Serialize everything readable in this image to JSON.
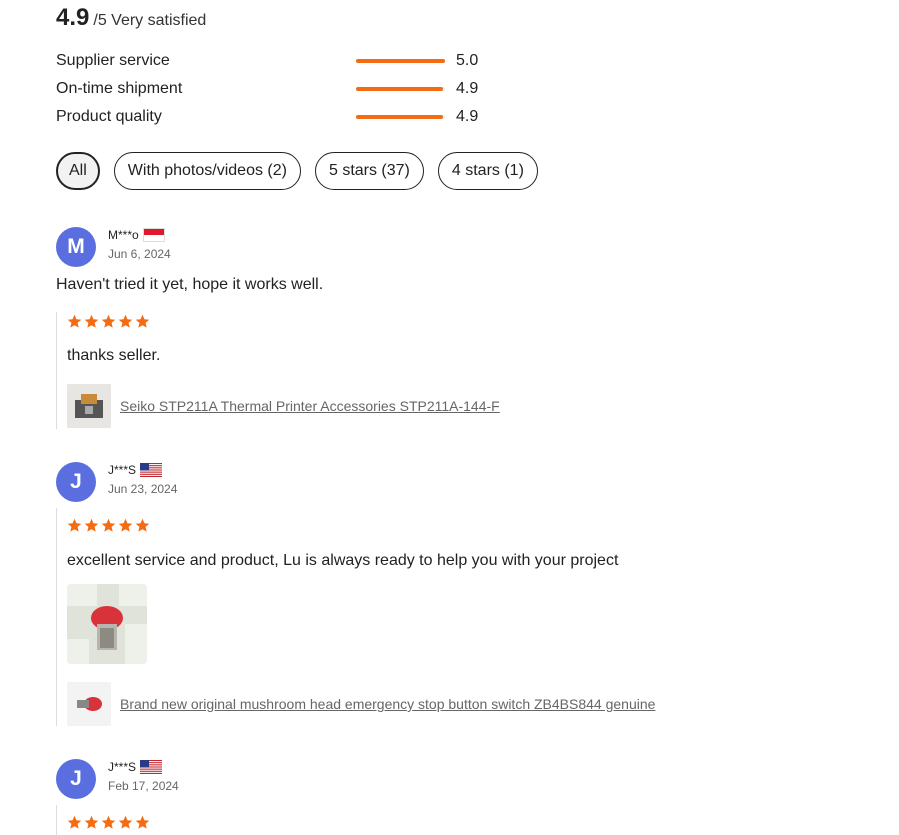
{
  "summary": {
    "score": "4.9",
    "score_sub": "/5 Very satisfied"
  },
  "metrics": [
    {
      "label": "Supplier service",
      "value": "5.0",
      "level": 1.0
    },
    {
      "label": "On-time shipment",
      "value": "4.9",
      "level": 0.98
    },
    {
      "label": "Product quality",
      "value": "4.9",
      "level": 0.98
    }
  ],
  "filters": [
    "All",
    "With photos/videos (2)",
    "5 stars (37)",
    "4 stars (1)"
  ],
  "reviews": [
    {
      "initial": "M",
      "name": "M***o",
      "flag": "indonesia-flag-icon",
      "date": "Jun 6, 2024",
      "title": "Haven't tried it yet, hope it works well.",
      "stars": 5,
      "text": "thanks seller.",
      "product": "Seiko STP211A Thermal Printer Accessories STP211A-144-F"
    },
    {
      "initial": "J",
      "name": "J***S",
      "flag": "usa-flag-icon",
      "date": "Jun 23, 2024",
      "stars": 5,
      "text": "excellent service and product, Lu is always ready to help you with your project",
      "product": "Brand new original mushroom head emergency stop button switch ZB4BS844 genuine"
    },
    {
      "initial": "J",
      "name": "J***S",
      "flag": "usa-flag-icon",
      "date": "Feb 17, 2024",
      "stars": 5
    }
  ],
  "colors": {
    "accent": "#f46b12",
    "avatar": "#5a6ee0"
  }
}
